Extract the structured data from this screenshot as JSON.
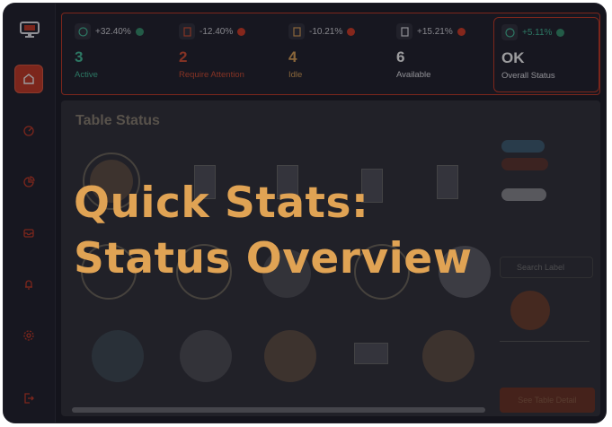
{
  "stats": [
    {
      "change": "+32.40%",
      "trend": "up",
      "value": "3",
      "label": "Active",
      "value_color": "#3fbf9a",
      "label_color": "#3fbf9a",
      "icon": "coin-icon"
    },
    {
      "change": "-12.40%",
      "trend": "down",
      "value": "2",
      "label": "Require Attention",
      "value_color": "#d84a2e",
      "label_color": "#d84a2e",
      "icon": "receipt-icon"
    },
    {
      "change": "-10.21%",
      "trend": "down",
      "value": "4",
      "label": "Idle",
      "value_color": "#e0a354",
      "label_color": "#e0a354",
      "icon": "receipt-icon"
    },
    {
      "change": "+15.21%",
      "trend": "down",
      "value": "6",
      "label": "Available",
      "value_color": "#ffffff",
      "label_color": "#e8e8ee",
      "icon": "receipt-icon"
    }
  ],
  "overall": {
    "change": "+5.11%",
    "trend": "up",
    "value": "OK",
    "label": "Overall Status",
    "icon": "coin-icon"
  },
  "main": {
    "title": "Table Status",
    "cta": "See Table Detail"
  },
  "right_panel": {
    "search_placeholder": "Search Label"
  },
  "overlay": {
    "line1": "Quick Stats:",
    "line2": "Status Overview"
  },
  "colors": {
    "accent": "#c8351f",
    "up": "#2f8f6a",
    "down": "#d8361f",
    "headline": "#e0a354"
  }
}
